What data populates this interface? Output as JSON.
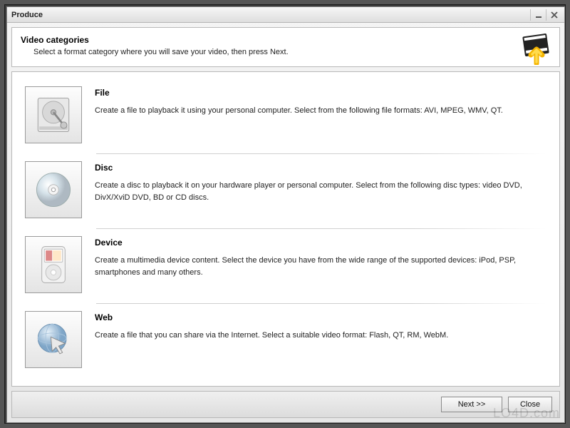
{
  "window": {
    "title": "Produce"
  },
  "header": {
    "title": "Video categories",
    "subtitle": "Select a format category where you will save your video, then press Next."
  },
  "categories": [
    {
      "id": "file",
      "title": "File",
      "description": "Create a file to playback it using your personal computer. Select from the following file formats: AVI, MPEG, WMV, QT."
    },
    {
      "id": "disc",
      "title": "Disc",
      "description": "Create a disc to playback it on your hardware player or personal computer. Select from the following disc types: video DVD, DivX/XviD DVD, BD or CD discs."
    },
    {
      "id": "device",
      "title": "Device",
      "description": "Create a multimedia device content. Select the device you have from the wide range of the supported devices: iPod, PSP, smartphones and many others."
    },
    {
      "id": "web",
      "title": "Web",
      "description": "Create a file that you can share via the Internet. Select a suitable video format: Flash, QT, RM, WebM."
    }
  ],
  "footer": {
    "next_label": "Next >>",
    "close_label": "Close"
  },
  "watermark": "LO4D.com"
}
